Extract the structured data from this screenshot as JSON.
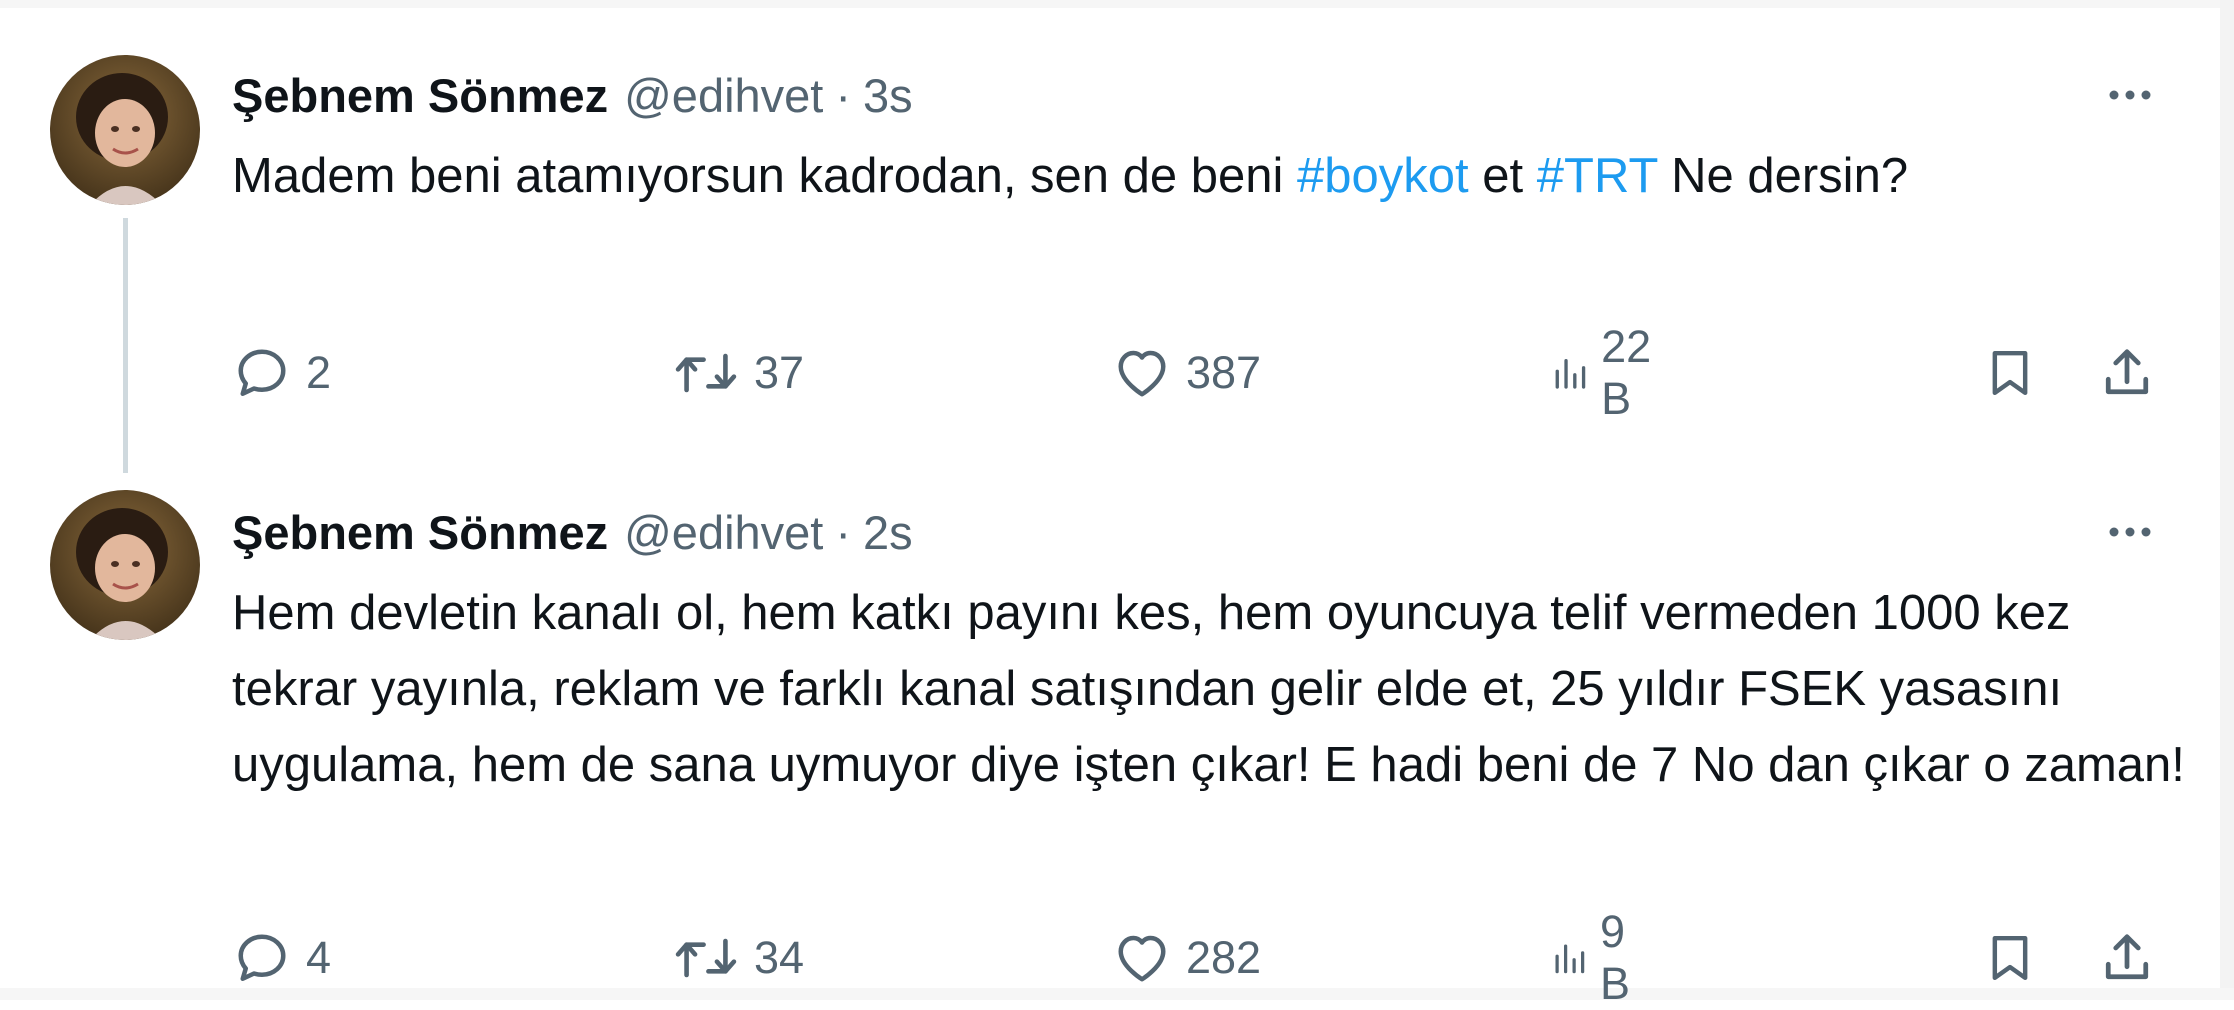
{
  "tweets": [
    {
      "author": "Şebnem Sönmez",
      "handle": "@edihvet",
      "dot": "·",
      "time": "3s",
      "text_before": "Madem beni atamıyorsun kadrodan, sen de beni ",
      "hashtag1": "#boykot",
      "text_middle": " et ",
      "hashtag2": "#TRT",
      "text_after": " Ne dersin?",
      "replies": "2",
      "retweets": "37",
      "likes": "387",
      "views": "22 B",
      "more_label": "···"
    },
    {
      "author": "Şebnem Sönmez",
      "handle": "@edihvet",
      "dot": "·",
      "time": "2s",
      "text": "Hem devletin kanalı ol, hem katkı payını kes, hem oyuncuya telif vermeden 1000 kez tekrar yayınla, reklam  ve farklı kanal satışından gelir elde et, 25 yıldır FSEK yasasını uygulama, hem de sana uymuyor diye işten çıkar! E hadi beni de 7 No dan çıkar o zaman!",
      "replies": "4",
      "retweets": "34",
      "likes": "282",
      "views": "9 B",
      "more_label": "···"
    }
  ],
  "colors": {
    "text": "#0f1419",
    "secondary": "#536471",
    "link": "#1d9bf0",
    "thread_line": "#cfd9de"
  },
  "icons": {
    "reply": "reply-icon",
    "retweet": "retweet-icon",
    "like": "heart-icon",
    "views": "views-icon",
    "bookmark": "bookmark-icon",
    "share": "share-icon",
    "more": "more-icon"
  }
}
